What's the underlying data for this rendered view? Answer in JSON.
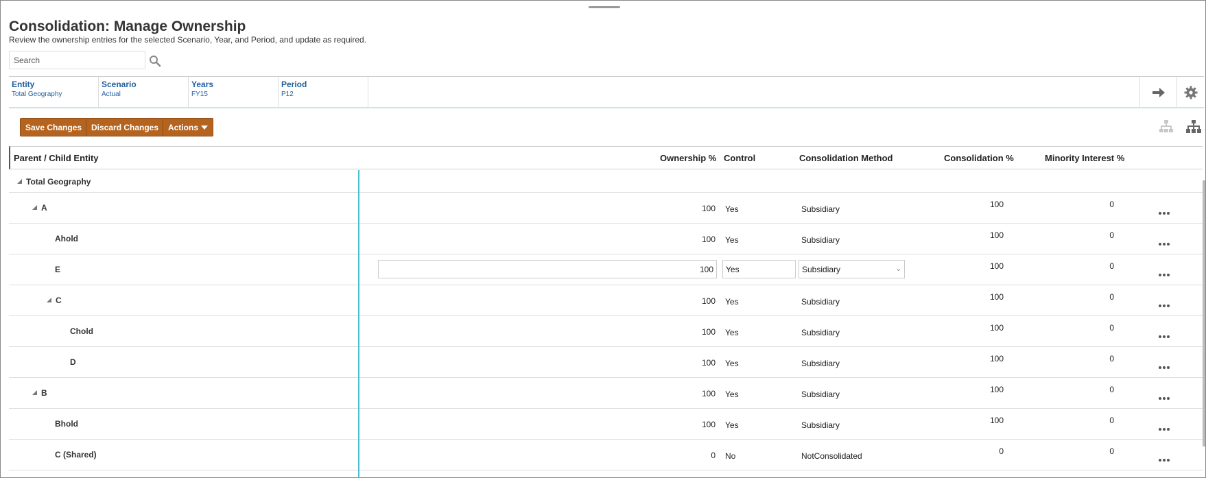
{
  "page": {
    "title": "Consolidation: Manage Ownership",
    "subtitle": "Review the ownership entries for the selected Scenario, Year, and Period, and update as required."
  },
  "search": {
    "placeholder": "Search"
  },
  "pov": [
    {
      "label": "Entity",
      "value": "Total Geography"
    },
    {
      "label": "Scenario",
      "value": "Actual"
    },
    {
      "label": "Years",
      "value": "FY15"
    },
    {
      "label": "Period",
      "value": "P12"
    }
  ],
  "toolbar": {
    "save_label": "Save Changes",
    "discard_label": "Discard Changes",
    "actions_label": "Actions"
  },
  "table": {
    "headers": {
      "entity": "Parent / Child Entity",
      "ownership": "Ownership %",
      "control": "Control",
      "method": "Consolidation Method",
      "consolidation": "Consolidation %",
      "minority": "Minority Interest %"
    },
    "group_row": {
      "entity": "Total Geography"
    },
    "rows": [
      {
        "entity": "A",
        "ownership": "100",
        "control": "Yes",
        "method": "Subsidiary",
        "consolidation": "100",
        "minority": "0"
      },
      {
        "entity": "Ahold",
        "ownership": "100",
        "control": "Yes",
        "method": "Subsidiary",
        "consolidation": "100",
        "minority": "0"
      },
      {
        "entity": "E",
        "ownership": "100",
        "control": "Yes",
        "method": "Subsidiary",
        "consolidation": "100",
        "minority": "0"
      },
      {
        "entity": "C",
        "ownership": "100",
        "control": "Yes",
        "method": "Subsidiary",
        "consolidation": "100",
        "minority": "0"
      },
      {
        "entity": "Chold",
        "ownership": "100",
        "control": "Yes",
        "method": "Subsidiary",
        "consolidation": "100",
        "minority": "0"
      },
      {
        "entity": "D",
        "ownership": "100",
        "control": "Yes",
        "method": "Subsidiary",
        "consolidation": "100",
        "minority": "0"
      },
      {
        "entity": "B",
        "ownership": "100",
        "control": "Yes",
        "method": "Subsidiary",
        "consolidation": "100",
        "minority": "0"
      },
      {
        "entity": "Bhold",
        "ownership": "100",
        "control": "Yes",
        "method": "Subsidiary",
        "consolidation": "100",
        "minority": "0"
      },
      {
        "entity": "C (Shared)",
        "ownership": "0",
        "control": "No",
        "method": "NotConsolidated",
        "consolidation": "0",
        "minority": "0"
      }
    ]
  },
  "icons": {
    "search": "search-icon",
    "pov_go": "arrow-right-icon",
    "settings": "gear-icon",
    "hierarchy_disabled": "hierarchy-icon",
    "hierarchy": "org-chart-icon",
    "row_actions": "more-actions-icon"
  },
  "colors": {
    "button_bg": "#b5641f",
    "pov_text": "#1f5fa0",
    "divider": "#4cbfd3"
  }
}
